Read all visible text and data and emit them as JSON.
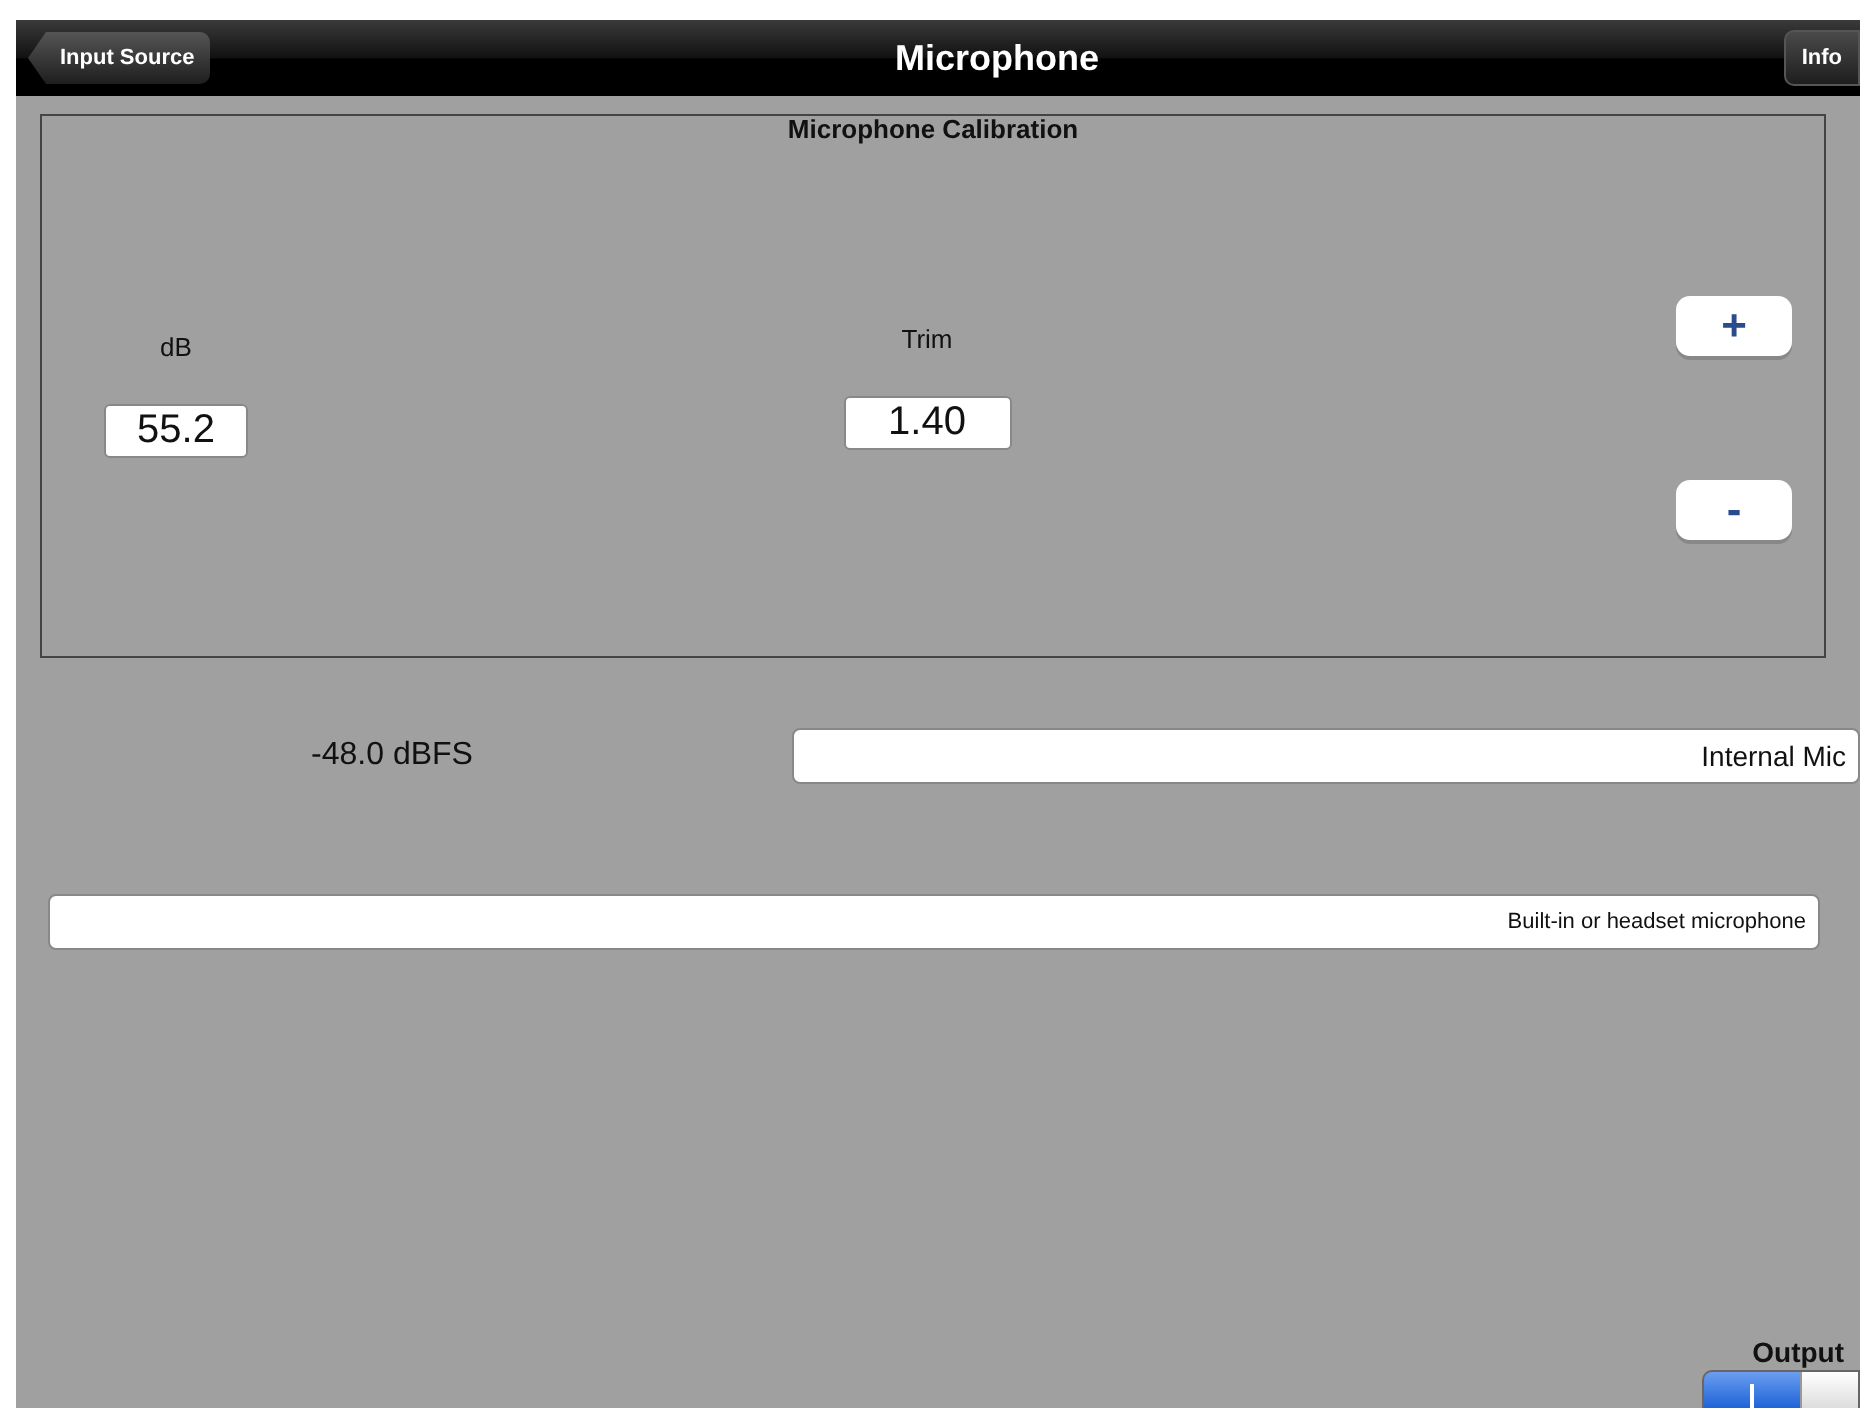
{
  "nav_bar": {
    "back_button": "Input Source",
    "title": "Microphone",
    "info_button": "Info"
  },
  "calibration": {
    "title": "Microphone Calibration",
    "db": {
      "label": "dB",
      "value": "55.2"
    },
    "trim": {
      "label": "Trim",
      "value": "1.40"
    },
    "plus_button": "+",
    "minus_button": "-"
  },
  "level_reading": "-48.0 dBFS",
  "input_name_field": {
    "value": "Internal Mic"
  },
  "description_field": {
    "value": "Built-in or headset microphone"
  },
  "output": {
    "label": "Output",
    "on": true
  }
}
